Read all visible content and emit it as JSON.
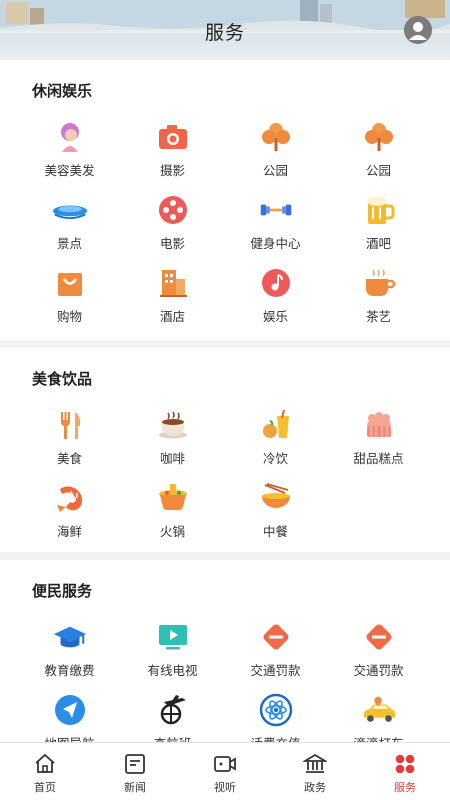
{
  "header": {
    "title": "服务"
  },
  "sections": [
    {
      "title": "休闲娱乐",
      "items": [
        {
          "label": "美容美发",
          "icon": "beauty-icon"
        },
        {
          "label": "摄影",
          "icon": "camera-icon"
        },
        {
          "label": "公园",
          "icon": "tree-icon"
        },
        {
          "label": "公园",
          "icon": "tree-icon"
        },
        {
          "label": "景点",
          "icon": "scenic-icon"
        },
        {
          "label": "电影",
          "icon": "film-reel-icon"
        },
        {
          "label": "健身中心",
          "icon": "dumbbell-icon"
        },
        {
          "label": "酒吧",
          "icon": "beer-icon"
        },
        {
          "label": "购物",
          "icon": "shopping-bag-icon"
        },
        {
          "label": "酒店",
          "icon": "hotel-icon"
        },
        {
          "label": "娱乐",
          "icon": "music-icon"
        },
        {
          "label": "茶艺",
          "icon": "tea-icon"
        }
      ]
    },
    {
      "title": "美食饮品",
      "items": [
        {
          "label": "美食",
          "icon": "fork-knife-icon"
        },
        {
          "label": "咖啡",
          "icon": "coffee-icon"
        },
        {
          "label": "冷饮",
          "icon": "cold-drink-icon"
        },
        {
          "label": "甜品糕点",
          "icon": "cake-icon"
        },
        {
          "label": "海鲜",
          "icon": "shrimp-icon"
        },
        {
          "label": "火锅",
          "icon": "hotpot-icon"
        },
        {
          "label": "中餐",
          "icon": "noodle-bowl-icon"
        }
      ]
    },
    {
      "title": "便民服务",
      "items": [
        {
          "label": "教育缴费",
          "icon": "graduation-cap-icon"
        },
        {
          "label": "有线电视",
          "icon": "tv-icon"
        },
        {
          "label": "交通罚款",
          "icon": "no-entry-icon"
        },
        {
          "label": "交通罚款",
          "icon": "no-entry-icon"
        },
        {
          "label": "地图导航",
          "icon": "navigation-icon"
        },
        {
          "label": "查航班",
          "icon": "flight-icon"
        },
        {
          "label": "话费充值",
          "icon": "atom-icon"
        },
        {
          "label": "滴滴打车",
          "icon": "taxi-icon"
        }
      ]
    }
  ],
  "tabs": [
    {
      "label": "首页",
      "icon": "home-icon",
      "active": false
    },
    {
      "label": "新闻",
      "icon": "news-icon",
      "active": false
    },
    {
      "label": "视听",
      "icon": "video-icon",
      "active": false
    },
    {
      "label": "政务",
      "icon": "government-icon",
      "active": false
    },
    {
      "label": "服务",
      "icon": "services-icon",
      "active": true
    }
  ],
  "colors": {
    "accent": "#e23b3b",
    "orange": "#f08a3c",
    "blue": "#2a8ee6",
    "teal": "#2fbfb5"
  }
}
